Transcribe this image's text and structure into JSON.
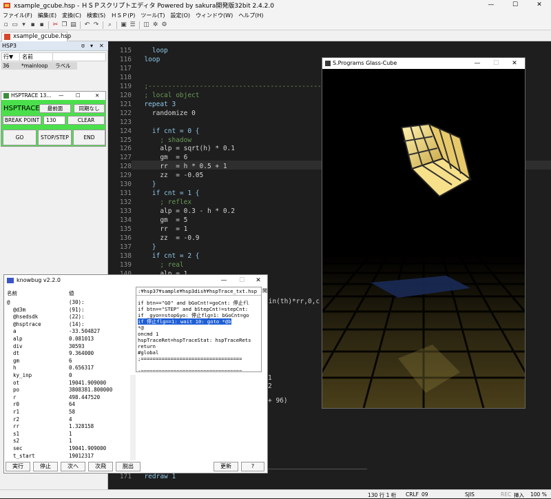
{
  "window": {
    "title": "xsample_gcube.hsp - ＨＳＰスクリプトエディタ Powered by sakura開発版32bit 2.4.2.0",
    "controls": [
      "—",
      "☐",
      "✕"
    ]
  },
  "menu": [
    "ファイル(F)",
    "編集(E)",
    "変換(C)",
    "検索(S)",
    "ＨＳＰ(P)",
    "ツール(T)",
    "設定(O)",
    "ウィンドウ(W)",
    "ヘルプ(H)"
  ],
  "tab": {
    "label": "xsample_gcube.hsp"
  },
  "hsp3_panel": {
    "title": "HSP3",
    "controls": [
      "ʊ",
      "▾",
      "✕"
    ],
    "columns": [
      "行▼",
      "名前"
    ],
    "rows": [
      {
        "line": "36",
        "name": "*mainloop",
        "kind": "ラベル"
      }
    ]
  },
  "editor": {
    "lines": [
      {
        "num": "115",
        "text": "    loop"
      },
      {
        "num": "116",
        "text": "  loop"
      },
      {
        "num": "117",
        "text": ""
      },
      {
        "num": "118",
        "text": ""
      },
      {
        "num": "119",
        "text": "  ;-----------------------------------------------------------"
      },
      {
        "num": "120",
        "text": "  ; local object"
      },
      {
        "num": "121",
        "text": "  repeat 3"
      },
      {
        "num": "122",
        "text": "    randomize 0"
      },
      {
        "num": "123",
        "text": ""
      },
      {
        "num": "124",
        "text": "    if cnt = 0 {"
      },
      {
        "num": "125",
        "text": "      ; shadow"
      },
      {
        "num": "126",
        "text": "      alp = sqrt(h) * 0.1"
      },
      {
        "num": "127",
        "text": "      gm  = 6"
      },
      {
        "num": "128",
        "text": "      rr  = h * 0.5 + 1"
      },
      {
        "num": "129",
        "text": "      zz  = -0.05"
      },
      {
        "num": "130",
        "text": "    }"
      },
      {
        "num": "131",
        "text": "    if cnt = 1 {"
      },
      {
        "num": "132",
        "text": "      ; reflex"
      },
      {
        "num": "133",
        "text": "      alp = 0.3 - h * 0.2"
      },
      {
        "num": "134",
        "text": "      gm  = 5"
      },
      {
        "num": "135",
        "text": "      rr  = 1"
      },
      {
        "num": "136",
        "text": "      zz  = -0.9"
      },
      {
        "num": "137",
        "text": "    }"
      },
      {
        "num": "138",
        "text": "    if cnt = 2 {"
      },
      {
        "num": "139",
        "text": "      ; real"
      },
      {
        "num": "140",
        "text": "      alp = 1"
      },
      {
        "num": "141",
        "text": "      zz  = 1"
      },
      {
        "num": "142",
        "text": "    }"
      },
      {
        "num": "143",
        "text": ""
      },
      {
        "num": "144",
        "text": "    r0 = 64 : r1 = 58 : r2 = 4"
      }
    ],
    "fragments": [
      "sin(th)*rr,0,c",
      "1",
      "2",
      "+ 96)"
    ],
    "bottom_line": {
      "num": "171",
      "text": "  redraw 1"
    }
  },
  "statusbar": {
    "position": "130 行   1 桁",
    "eol": "CRLF",
    "code": "09",
    "charset": "SJIS",
    "rec": "REC",
    "insert": "挿入",
    "zoom": "100 %"
  },
  "hsptrace": {
    "title": "HSPTRACE 13...",
    "controls": [
      "—",
      "☐",
      "✕"
    ],
    "label": "HSPTRACE",
    "front_button": "最前面",
    "sync_button": "同期なし",
    "breakpoint_button": "BREAK POINT",
    "breakpoint_value": "130",
    "clear_button": "CLEAR",
    "go_button": "GO",
    "stop_button": "STOP/STEP",
    "end_button": "END"
  },
  "glass_window": {
    "title": "S.Programs Glass-Cube",
    "controls": [
      "—",
      "☐",
      "✕"
    ]
  },
  "knowbug": {
    "title": "knowbug v2.2.0",
    "controls": [
      "—",
      "☐",
      "✕"
    ],
    "columns": [
      "名前",
      "値"
    ],
    "variables": [
      {
        "name": "@",
        "value": "(30):"
      },
      {
        "name": "  @d3m",
        "value": "(91):"
      },
      {
        "name": "  @hsedsdk",
        "value": "(22):"
      },
      {
        "name": "  @hsptrace",
        "value": "(14):"
      },
      {
        "name": "  a",
        "value": "-33.504827"
      },
      {
        "name": "  alp",
        "value": "0.081013"
      },
      {
        "name": "  div",
        "value": "30593"
      },
      {
        "name": "  dt",
        "value": "9.364000"
      },
      {
        "name": "  gm",
        "value": "6"
      },
      {
        "name": "  h",
        "value": "0.656317"
      },
      {
        "name": "  ky_inp",
        "value": "0"
      },
      {
        "name": "  ot",
        "value": "19041.909000"
      },
      {
        "name": "  po",
        "value": "3808381.800000"
      },
      {
        "name": "  r",
        "value": "498.447520"
      },
      {
        "name": "  r0",
        "value": "64"
      },
      {
        "name": "  r1",
        "value": "58"
      },
      {
        "name": "  r2",
        "value": "4"
      },
      {
        "name": "  rr",
        "value": "1.328158"
      },
      {
        "name": "  s1",
        "value": "1"
      },
      {
        "name": "  s2",
        "value": "1"
      },
      {
        "name": "  sec",
        "value": "19041.909000"
      },
      {
        "name": "  t_start",
        "value": "19012317"
      },
      {
        "name": "  th",
        "value": "-22391.229412"
      }
    ],
    "source_path": ":¥hsp37¥sample¥hsp3dish¥hspTrace_txt.hsp",
    "open_button": "開",
    "source_lines": [
      "if btn==\"GO\" and bGoCnt!=goCnt: 停止fl",
      "if btn==\"STEP\" and bStepCnt!=stepCnt:",
      "if _gyo==stopGyo: 停止flg=1: bGoCnt=go",
      "if 停止flg==1: wait 10: goto *@b",
      "*@",
      "oncmd 1",
      "hspTraceRet=hspTraceStat: hspTraceRets",
      "return",
      "#global",
      ";==================================",
      "",
      ";=================================="
    ],
    "buttons": [
      "実行",
      "停止",
      "次へ",
      "次飛",
      "脱出",
      "更新",
      "?"
    ]
  }
}
